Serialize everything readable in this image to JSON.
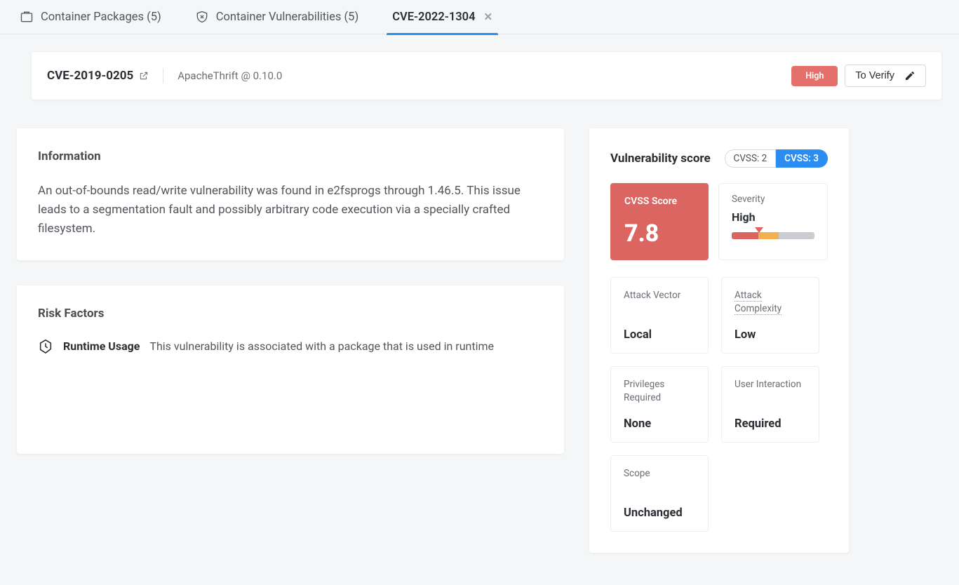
{
  "tabs": [
    {
      "label": "Container Packages (5)"
    },
    {
      "label": "Container Vulnerabilities (5)"
    },
    {
      "label": "CVE-2022-1304",
      "active": true,
      "closable": true
    }
  ],
  "header": {
    "cve_id": "CVE-2019-0205",
    "package_ref": "ApacheThrift @ 0.10.0",
    "severity_badge": "High",
    "verify_label": "To Verify"
  },
  "info": {
    "title": "Information",
    "body": "An out-of-bounds read/write vulnerability was found in e2fsprogs through 1.46.5. This issue leads to a segmentation fault and possibly arbitrary code execution via a specially crafted filesystem."
  },
  "risk": {
    "title": "Risk Factors",
    "item_label": "Runtime Usage",
    "item_desc": "This vulnerability is associated with a package that is used in runtime"
  },
  "score": {
    "heading": "Vulnerability score",
    "pill_cvss2": "CVSS: 2",
    "pill_cvss3": "CVSS: 3",
    "cvss_label": "CVSS Score",
    "cvss_value": "7.8",
    "sev_label": "Severity",
    "sev_value": "High",
    "metrics": [
      {
        "label": "Attack Vector",
        "value": "Local"
      },
      {
        "label": "Attack Complexity",
        "value": "Low",
        "dotted": true
      },
      {
        "label": "Privileges Required",
        "value": "None"
      },
      {
        "label": "User Interaction",
        "value": "Required"
      },
      {
        "label": "Scope",
        "value": "Unchanged"
      }
    ]
  }
}
